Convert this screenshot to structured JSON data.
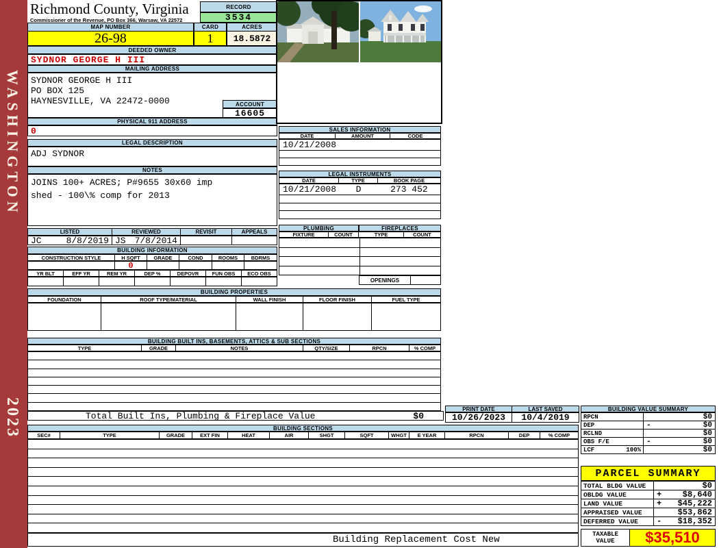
{
  "colors": {
    "bar_blue": "#BCD9E9",
    "record_green": "#99E699",
    "highlight_yellow": "#FFFF00",
    "acres_cream": "#F8F4E1",
    "sidebar_red": "#A63A3A",
    "data_red": "#C80000",
    "taxable_red": "#E00000"
  },
  "sidebar": {
    "county": "WASHINGTON",
    "year": "2023"
  },
  "header": {
    "title": "Richmond County, Virginia",
    "subtitle": "Commissioner of the Revenue, PO Box 366, Warsaw, VA 22572",
    "record_label": "RECORD",
    "record_value": "3534",
    "map_number_label": "MAP NUMBER",
    "map_number": "26-98",
    "card_label": "CARD",
    "card": "1",
    "acres_label": "ACRES",
    "acres": "18.5872"
  },
  "owner": {
    "deeded_owner_label": "DEEDED OWNER",
    "deeded_owner": "SYDNOR GEORGE H III",
    "mailing_address_label": "MAILING ADDRESS",
    "mailing": [
      "SYDNOR GEORGE H III",
      "PO BOX 125",
      "",
      "HAYNESVILLE, VA 22472-0000"
    ],
    "account_label": "ACCOUNT",
    "account": "16605",
    "physical_label": "PHYSICAL 911 ADDRESS",
    "physical": "0"
  },
  "legal": {
    "label": "LEGAL DESCRIPTION",
    "value": "ADJ SYDNOR"
  },
  "notes": {
    "label": "NOTES",
    "lines": [
      "JOINS 100+ ACRES; P#9655 30x60 imp",
      "shed - 100\\% comp for 2013"
    ]
  },
  "review": {
    "headers": [
      "LISTED",
      "REVIEWED",
      "REVISIT",
      "APPEALS"
    ],
    "listed_by": "JC",
    "listed_date": "8/8/2019",
    "reviewed_by": "JS",
    "reviewed_date": "7/8/2014",
    "revisit": "",
    "appeals": ""
  },
  "building_info": {
    "label": "BUILDING INFORMATION",
    "row1_headers": [
      "CONSTRUCTION STYLE",
      "H SQFT",
      "GRADE",
      "COND",
      "ROOMS",
      "BDRMS"
    ],
    "h_sqft": "0",
    "row2_headers": [
      "YR BLT",
      "EFF YR",
      "REM YR",
      "DEP %",
      "DEPOVR",
      "FUN OBS",
      "ECO OBS"
    ]
  },
  "sales": {
    "label": "SALES INFORMATION",
    "headers": [
      "DATE",
      "AMOUNT",
      "CODE"
    ],
    "rows": [
      [
        "10/21/2008",
        "",
        ""
      ],
      [
        "",
        "",
        ""
      ],
      [
        "",
        "",
        ""
      ]
    ]
  },
  "instruments": {
    "label": "LEGAL INSTRUMENTS",
    "headers": [
      "DATE",
      "TYPE",
      "BOOK PAGE"
    ],
    "rows": [
      [
        "10/21/2008",
        "D",
        "273 452"
      ],
      [
        "",
        "",
        ""
      ],
      [
        "",
        "",
        ""
      ],
      [
        "",
        "",
        ""
      ]
    ]
  },
  "plumbing": {
    "label": "PLUMBING",
    "headers": [
      "FIXTURE",
      "COUNT"
    ]
  },
  "fireplaces": {
    "label": "FIREPLACES",
    "headers": [
      "TYPE",
      "COUNT"
    ],
    "openings_label": "OPENINGS"
  },
  "properties": {
    "label": "BUILDING PROPERTIES",
    "headers": [
      "FOUNDATION",
      "ROOF TYPE/MATERIAL",
      "WALL FINISH",
      "FLOOR FINISH",
      "FUEL TYPE"
    ]
  },
  "builtins": {
    "label": "BUILDING BUILT INS, BASEMENTS, ATTICS & SUB SECTIONS",
    "headers": [
      "TYPE",
      "GRADE",
      "NOTES",
      "QTY/SIZE",
      "RPCN",
      "% COMP"
    ],
    "total_label": "Total Built Ins, Plumbing & Fireplace Value",
    "total_value": "$0"
  },
  "print_info": {
    "print_date_label": "PRINT DATE",
    "print_date": "10/26/2023",
    "last_saved_label": "LAST SAVED",
    "last_saved": "10/4/2019"
  },
  "bvs": {
    "label": "BUILDING VALUE SUMMARY",
    "rows": [
      {
        "label": "RPCN",
        "pct": "",
        "op": "",
        "value": "$0"
      },
      {
        "label": "DEP",
        "pct": "",
        "op": "-",
        "value": "$0"
      },
      {
        "label": "RCLND",
        "pct": "",
        "op": "",
        "value": "$0"
      },
      {
        "label": "OBS F/E",
        "pct": "",
        "op": "-",
        "value": "$0"
      },
      {
        "label": "LCF",
        "pct": "100%",
        "op": "",
        "value": "$0"
      }
    ]
  },
  "sections": {
    "label": "BUILDING SECTIONS",
    "headers": [
      "SEC#",
      "TYPE",
      "GRADE",
      "EXT FIN",
      "HEAT",
      "AIR",
      "SHGT",
      "SQFT",
      "WHGT",
      "E YEAR",
      "RPCN",
      "DEP",
      "% COMP"
    ],
    "footer": "Building Replacement Cost New"
  },
  "parcel": {
    "label": "PARCEL SUMMARY",
    "rows": [
      {
        "label": "TOTAL BLDG VALUE",
        "op": "",
        "value": "$0"
      },
      {
        "label": "OBLDG VALUE",
        "op": "+",
        "value": "$8,640"
      },
      {
        "label": "LAND VALUE",
        "op": "+",
        "value": "$45,222"
      },
      {
        "label": "APPRAISED VALUE",
        "op": "",
        "value": "$53,862"
      },
      {
        "label": "DEFERRED VALUE",
        "op": "-",
        "value": "$18,352"
      }
    ],
    "taxable_label_1": "TAXABLE",
    "taxable_label_2": "VALUE",
    "taxable": "$35,510"
  }
}
